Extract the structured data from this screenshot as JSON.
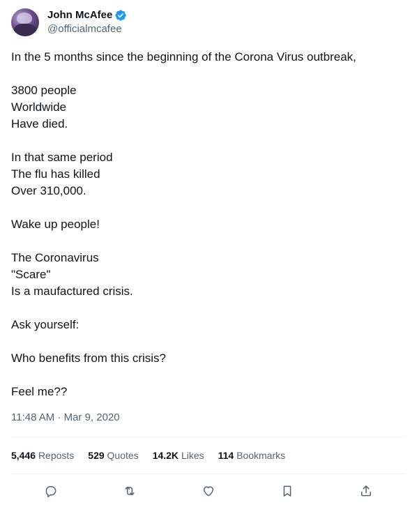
{
  "author": {
    "name": "John McAfee",
    "handle": "@officialmcafee"
  },
  "tweet": {
    "text": "In the 5 months since the beginning of the Corona Virus outbreak,\n\n3800 people\nWorldwide\nHave died.\n\nIn that same period\nThe flu has killed\nOver 310,000.\n\nWake up people!\n\nThe Coronavirus\n\"Scare\"\nIs a maufactured crisis.\n\nAsk yourself:\n\nWho benefits from this crisis?\n\nFeel me??",
    "timestamp": "11:48 AM · Mar 9, 2020"
  },
  "stats": [
    {
      "count": "5,446",
      "label": "Reposts"
    },
    {
      "count": "529",
      "label": "Quotes"
    },
    {
      "count": "14.2K",
      "label": "Likes"
    },
    {
      "count": "114",
      "label": "Bookmarks"
    }
  ],
  "colors": {
    "verified": "#1d9bf0",
    "secondary_text": "#536471",
    "divider": "#eff3f4"
  },
  "icons": [
    "verified-badge-icon",
    "reply-icon",
    "repost-icon",
    "like-icon",
    "bookmark-icon",
    "share-icon"
  ]
}
